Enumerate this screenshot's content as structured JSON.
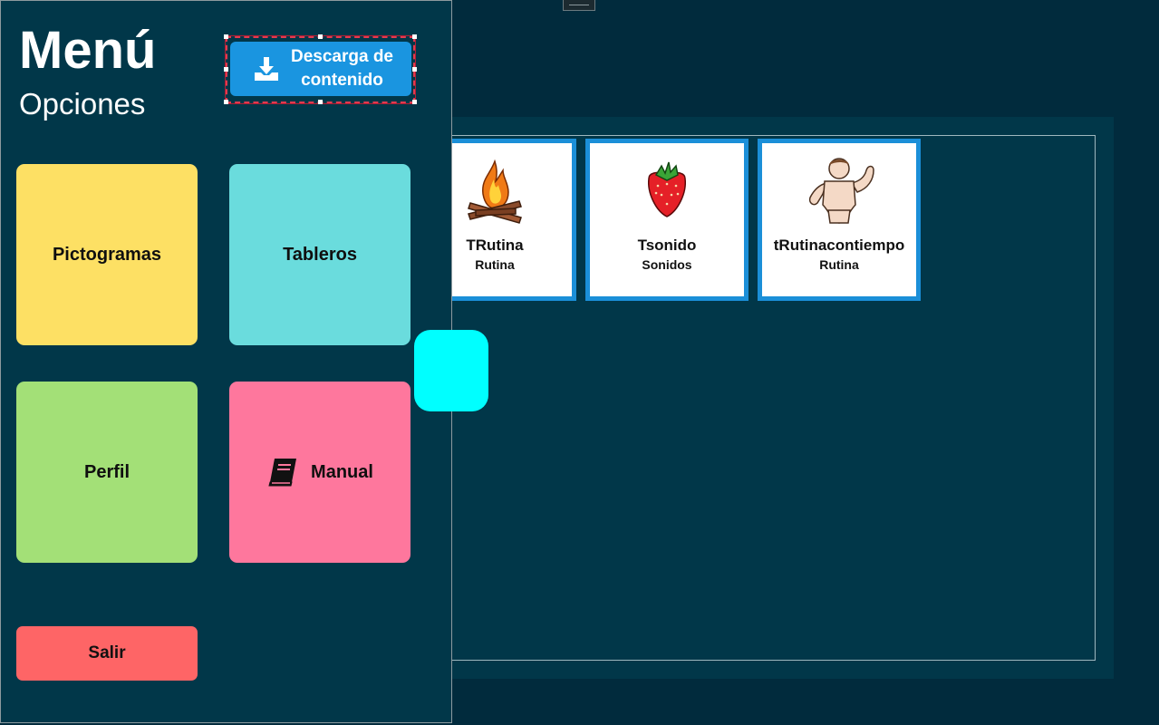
{
  "menu": {
    "title": "Menú",
    "subtitle": "Opciones",
    "download_label_line1": "Descarga de",
    "download_label_line2": "contenido",
    "tiles": {
      "pictogramas": "Pictogramas",
      "tableros": "Tableros",
      "perfil": "Perfil",
      "manual": "Manual"
    },
    "exit_label": "Salir"
  },
  "board": {
    "cards": [
      {
        "name": "TRutina",
        "category": "Rutina",
        "icon": "campfire-icon"
      },
      {
        "name": "Tsonido",
        "category": "Sonidos",
        "icon": "strawberry-icon"
      },
      {
        "name": "tRutinacontiempo",
        "category": "Rutina",
        "icon": "strong-man-icon"
      }
    ]
  },
  "colors": {
    "background": "#012b3d",
    "panel": "#013749",
    "accent_blue": "#1a95e0",
    "pictogramas": "#fde064",
    "tableros": "#6adcdd",
    "perfil": "#a3e077",
    "manual": "#fe779d",
    "salir": "#fe6566",
    "toggle": "#00ffff"
  }
}
